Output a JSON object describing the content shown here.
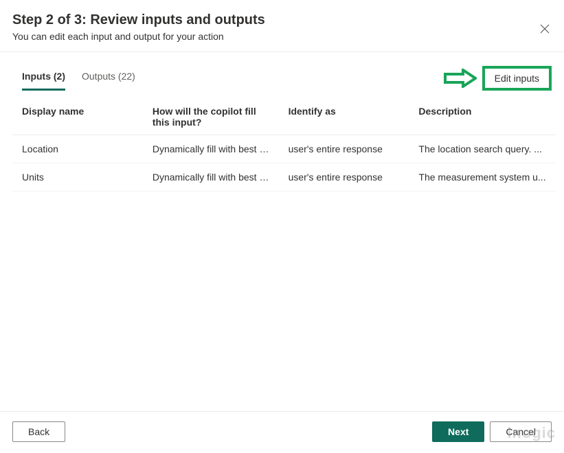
{
  "header": {
    "title": "Step 2 of 3: Review inputs and outputs",
    "subtitle": "You can edit each input and output for your action"
  },
  "tabs": {
    "inputs_label": "Inputs (2)",
    "outputs_label": "Outputs (22)"
  },
  "edit_button_label": "Edit inputs",
  "columns": {
    "display_name": "Display name",
    "how_fill": "How will the copilot fill this input?",
    "identify_as": "Identify as",
    "description": "Description"
  },
  "rows": [
    {
      "display_name": "Location",
      "how_fill": "Dynamically fill with best o...",
      "identify_as": "user's entire response",
      "description": "The location search query. ..."
    },
    {
      "display_name": "Units",
      "how_fill": "Dynamically fill with best o...",
      "identify_as": "user's entire response",
      "description": "The measurement system u..."
    }
  ],
  "footer": {
    "back": "Back",
    "next": "Next",
    "cancel": "Cancel"
  },
  "watermark": "inogic"
}
